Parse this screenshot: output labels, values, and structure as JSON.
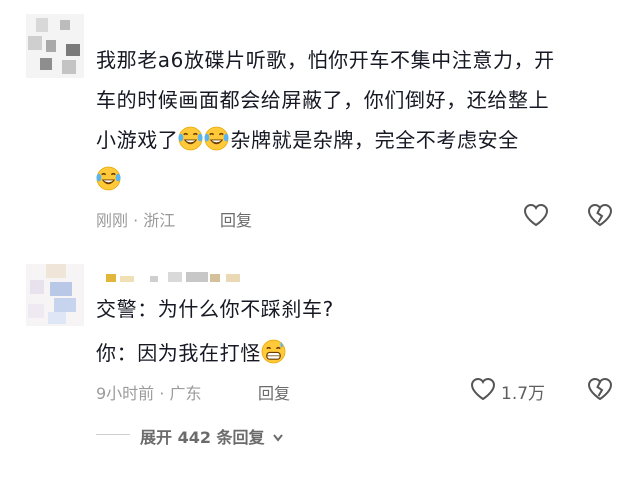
{
  "comment1": {
    "lines": [
      "我那老a6放碟片听歌，怕你开车不集中注意力，开",
      "车的时候画面都会给屏蔽了，你们倒好，还给整上",
      "小游戏了",
      "杂牌就是杂牌，完全不考虑安全"
    ],
    "emoji": "laughing-crying-emoji",
    "meta": "刚刚 · 浙江",
    "reply_label": "回复"
  },
  "comment2": {
    "line1": "交警：为什么你不踩刹车?",
    "line2": "你：因为我在打怪",
    "emoji": "grinning-sweat-emoji",
    "meta": "9小时前 · 广东",
    "reply_label": "回复",
    "like_count": "1.7万"
  },
  "expand": {
    "label": "展开 442 条回复"
  },
  "colors": {
    "text": "#161823",
    "meta": "#9b9b9b",
    "secondary": "#6b6b6b"
  }
}
